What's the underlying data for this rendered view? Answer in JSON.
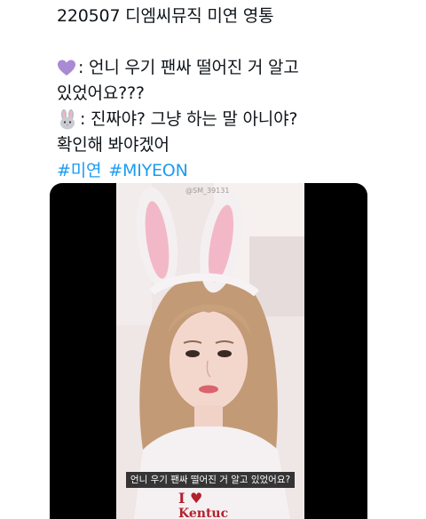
{
  "tweet": {
    "line1": "220507 디엠씨뮤직 미연 영통",
    "line2": ": 언니 우기 팬싸 떨어진 거 알고",
    "line3": "있었어요???",
    "line4": ": 진짜야? 그냥 하는 말 아니야?",
    "line5": "확인해 봐야겠어",
    "hashtag1": "#미연",
    "hashtag2": "#MIYEON",
    "emoji1": "purple-heart",
    "emoji2": "rabbit-face",
    "hashtag_color": "#1d9bf0"
  },
  "video": {
    "watermark": "@SM_39131",
    "subtitle": "언니 우기 팬싸 떨어진 거 알고 있었어요?"
  }
}
